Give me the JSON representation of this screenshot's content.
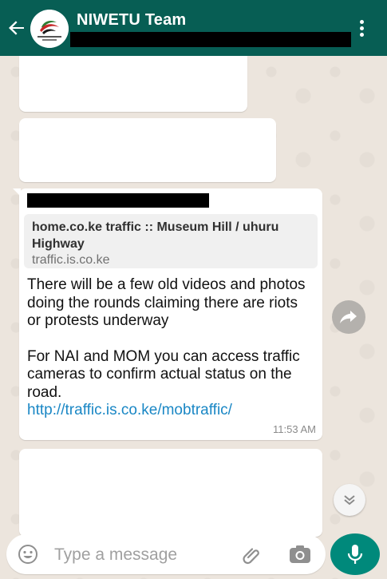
{
  "header": {
    "title": "NIWETU Team",
    "avatar_icon": "niwetu-logo",
    "back_icon": "back-arrow-icon",
    "menu_icon": "more-vertical-icon"
  },
  "message": {
    "link_preview": {
      "title": "home.co.ke traffic :: Museum Hill / uhuru Highway",
      "domain": "traffic.is.co.ke"
    },
    "paragraph1": "There will be a few old videos and photos doing the rounds claiming there are riots or protests underway",
    "paragraph2": "For NAI and MOM you can access traffic cameras to confirm actual status on the road.",
    "link": "http://traffic.is.co.ke/mobtraffic/",
    "time": "11:53 AM"
  },
  "composer": {
    "placeholder": "Type a message"
  },
  "colors": {
    "header": "#075e54",
    "link": "#1a87c5",
    "mic": "#00897b"
  }
}
